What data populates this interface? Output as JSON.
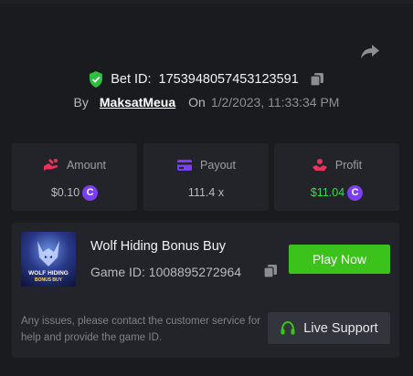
{
  "bet": {
    "label": "Bet ID:",
    "id": "1753948057453123591",
    "by_label": "By",
    "username": "MaksatMeua",
    "on_label": "On",
    "date": "1/2/2023, 11:33:34 PM"
  },
  "stats": {
    "amount": {
      "label": "Amount",
      "value": "$0.10"
    },
    "payout": {
      "label": "Payout",
      "value": "111.4 x"
    },
    "profit": {
      "label": "Profit",
      "value": "$11.04"
    }
  },
  "coin_symbol": "C",
  "game": {
    "title": "Wolf Hiding Bonus Buy",
    "id_label": "Game ID:",
    "id": "1008895272964",
    "thumb_text_1": "WOLF HIDING",
    "thumb_text_2": "BONUS BUY",
    "play_label": "Play Now"
  },
  "support": {
    "text": "Any issues, please contact the customer service for help and provide the game ID.",
    "button_label": "Live Support"
  },
  "colors": {
    "accent_green": "#3bc31b",
    "profit_green": "#3ed45b",
    "coin_purple": "#7b3ff2",
    "amount_icon": "#e8345a",
    "payout_icon": "#7b3ff2",
    "profit_icon": "#e8345a"
  }
}
